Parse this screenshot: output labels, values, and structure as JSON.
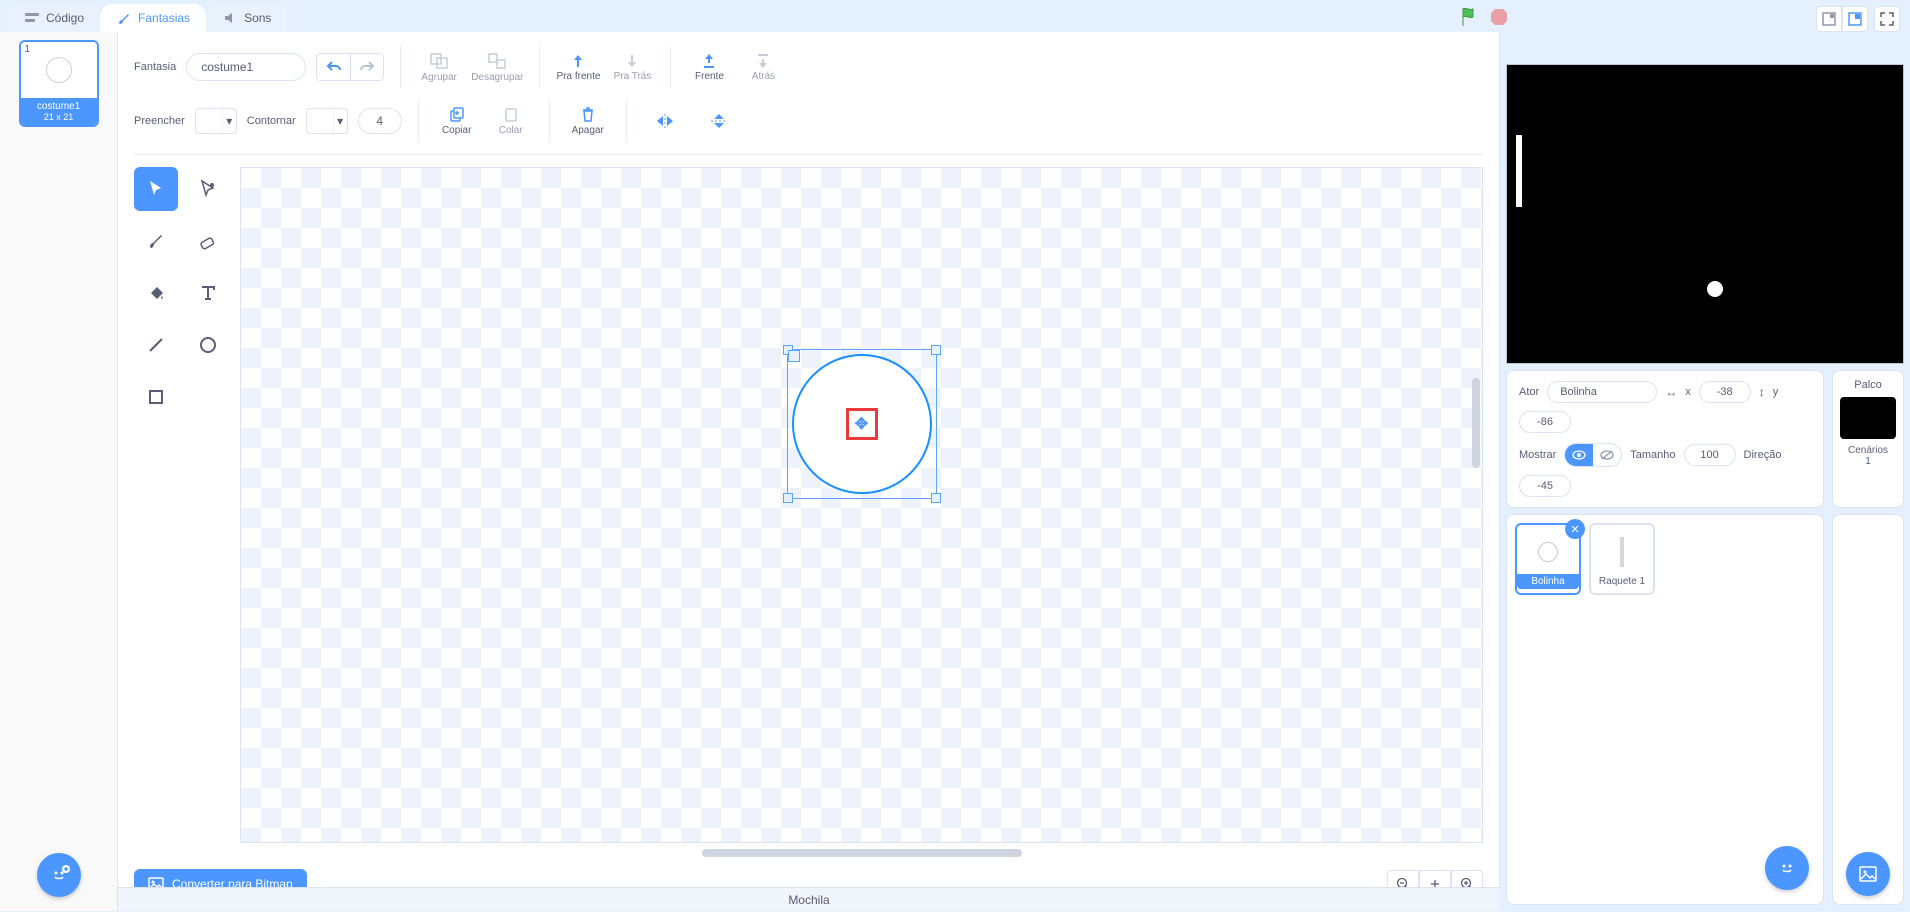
{
  "tabs": {
    "code": "Código",
    "costumes": "Fantasias",
    "sounds": "Sons"
  },
  "costume_thumb": {
    "number": "1",
    "name": "costume1",
    "dim": "21 x 21"
  },
  "toolbar": {
    "costume_label": "Fantasia",
    "costume_name": "costume1",
    "group": "Agrupar",
    "ungroup": "Desagrupar",
    "forward": "Pra frente",
    "backward": "Pra Trás",
    "front": "Frente",
    "back": "Atrás",
    "fill_label": "Preencher",
    "outline_label": "Contornar",
    "outline_width": "4",
    "copy": "Copiar",
    "paste": "Colar",
    "delete": "Apagar"
  },
  "convert_button": "Converter para Bitmap",
  "sprite_info": {
    "actor_label": "Ator",
    "actor_name": "Bolinha",
    "x_label": "x",
    "x_value": "-38",
    "y_label": "y",
    "y_value": "-86",
    "show_label": "Mostrar",
    "size_label": "Tamanho",
    "size_value": "100",
    "direction_label": "Direção",
    "direction_value": "-45"
  },
  "sprites": [
    {
      "name": "Bolinha",
      "selected": true
    },
    {
      "name": "Raquete 1",
      "selected": false
    }
  ],
  "stage_panel": {
    "title": "Palco",
    "subtitle": "Cenários",
    "count": "1"
  },
  "backpack": "Mochila"
}
